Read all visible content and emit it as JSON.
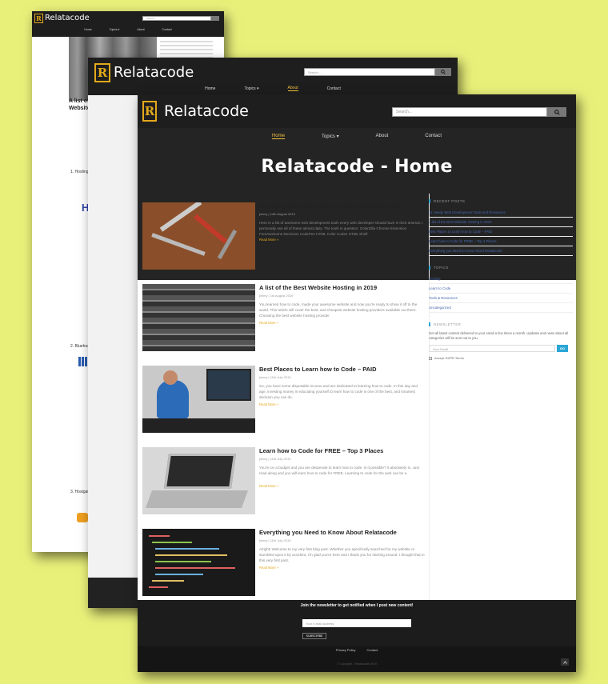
{
  "brand": {
    "name": "Relatacode",
    "mark": "R"
  },
  "search": {
    "placeholder": "Search..."
  },
  "nav": {
    "items": [
      "Home",
      "Topics ▾",
      "About",
      "Contact"
    ]
  },
  "pages": {
    "back": {
      "post_title": "A list of the Best Website Hosting in 2019",
      "sections": [
        "1. Hosting",
        "2. Bluehost",
        "3. Hostgator"
      ],
      "hero_letter": "H"
    },
    "middle": {
      "active": "About"
    }
  },
  "front": {
    "hero_title": "Relatacode - Home",
    "posts": [
      {
        "title": "11 Handy Web Development Tools and Resources",
        "meta": "jimmy | 14th August 2019",
        "excerpt": "Here is a list of awesome web development tools every web developer should have in their arsenal. I personally use all of these almost daily. The tools in question: ColorZilla Chrome Extension FontAwesome Devicons CodePen HTML Color Codes HTML Shell",
        "more": "Read More »"
      },
      {
        "title": "A list of the Best Website Hosting in 2019",
        "meta": "jimmy | 1st August 2019",
        "excerpt": "You learned how to code, made your awesome website and now you're ready to show it off to the world. This article will cover the best, and cheapest website hosting providers available out there. Choosing the best website hosting provider",
        "more": "Read More »"
      },
      {
        "title": "Best Places to Learn how to Code – PAID",
        "meta": "jimmy | 11th July 2019",
        "excerpt": "So, you have some disposable income and are dedicated to learning how to code. In this day and age, investing money in educating yourself to learn how to code is one of the best, and smartest decision you can do.",
        "more": "Read More »"
      },
      {
        "title": "Learn how to Code for FREE – Top 3 Places",
        "meta": "jimmy | 11th July 2019",
        "excerpt": "You're on a budget and you are desperate to learn how to code. Is it possible? It absolutely is. Just read along and you will learn how to code for FREE. Learning to code for the web can be a",
        "more": "Read More »"
      },
      {
        "title": "Everything you Need to Know About Relatacode",
        "meta": "jimmy | 11th July 2019",
        "excerpt": "Alright! Welcome to my very first blog post. Whether you specifically searched for my website or stumbled upon it by accident, I'm glad you're here and I thank you for sticking around. I thought that in this very first post,",
        "more": "Read More »"
      }
    ],
    "sidebar": {
      "recent_heading": "RECENT POSTS",
      "recent": [
        "11 Handy Web Development Tools and Resources",
        "A list of the Best Website Hosting in 2019",
        "Best Places to Learn how to Code – PAID",
        "Learn how to Code for FREE – Top 3 Places",
        "Everything you Need to Know About Relatacode"
      ],
      "topics_heading": "TOPICS",
      "topics": [
        "Hosting",
        "Learn to Code",
        "Tools & Resources",
        "Uncategorized"
      ],
      "newsletter_heading": "NEWSLETTER",
      "newsletter_text": "Get all latest content delivered to your email a few times a month. Updates and news about all categories will be sent out to you.",
      "email_placeholder": "Your Email",
      "go_label": "GO",
      "gdpr_label": "Accept GDPR Terms"
    },
    "footer": {
      "cta": "Join the newsletter to get notified when I post new content!",
      "email_placeholder": "Your e-mail address",
      "subscribe": "SUBSCRIBE",
      "links": [
        "Privacy Policy",
        "Contact"
      ],
      "copyright": "© Copyright - Relatacode 2019"
    }
  },
  "colors": {
    "bg": "#e9f07a",
    "accent": "#e3a91b",
    "header": "#1e1e1e"
  }
}
